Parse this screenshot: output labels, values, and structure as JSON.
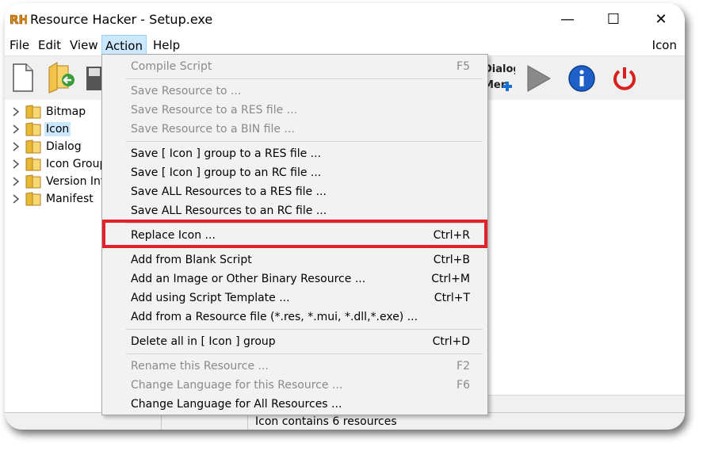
{
  "window": {
    "title": "Resource Hacker - Setup.exe",
    "app_logo_text": "RH",
    "minimize_glyph": "—",
    "maximize_glyph": "☐",
    "close_glyph": "✕"
  },
  "menubar": {
    "items": [
      "File",
      "Edit",
      "View",
      "Action",
      "Help"
    ],
    "active": "Action",
    "right_label": "Icon"
  },
  "toolbar": {
    "icons": [
      "new-file-icon",
      "open-folder-icon",
      "save-icon",
      "dialog-merger-icon",
      "run-script-icon",
      "info-icon",
      "power-icon"
    ],
    "dialog_merger_text_1": "Dialog",
    "dialog_merger_text_2": "Mer"
  },
  "tree": {
    "items": [
      {
        "label": "Bitmap",
        "selected": false
      },
      {
        "label": "Icon",
        "selected": true
      },
      {
        "label": "Dialog",
        "selected": false
      },
      {
        "label": "Icon Group",
        "selected": false
      },
      {
        "label": "Version Info",
        "selected": false
      },
      {
        "label": "Manifest",
        "selected": false
      }
    ]
  },
  "statusbar": {
    "text": "Icon contains 6 resources"
  },
  "action_menu": {
    "compile_script": {
      "label": "Compile Script",
      "shortcut": "F5"
    },
    "save_resource_to": {
      "label": "Save Resource to ..."
    },
    "save_resource_res": {
      "label": "Save Resource to a RES file ..."
    },
    "save_resource_bin": {
      "label": "Save Resource to a BIN file ..."
    },
    "save_group_res": {
      "label": "Save [ Icon ] group to a RES file ..."
    },
    "save_group_rc": {
      "label": "Save [ Icon ] group to an RC file ..."
    },
    "save_all_res": {
      "label": "Save ALL Resources to a RES file ..."
    },
    "save_all_rc": {
      "label": "Save ALL Resources to an RC file ..."
    },
    "replace_icon": {
      "label": "Replace Icon ...",
      "shortcut": "Ctrl+R"
    },
    "add_blank_script": {
      "label": "Add from Blank Script",
      "shortcut": "Ctrl+B"
    },
    "add_image_binary": {
      "label": "Add an Image or Other Binary Resource ...",
      "shortcut": "Ctrl+M"
    },
    "add_script_template": {
      "label": "Add using Script Template ...",
      "shortcut": "Ctrl+T"
    },
    "add_resource_file": {
      "label": "Add from a Resource file (*.res, *.mui, *.dll,*.exe) ..."
    },
    "delete_all_group": {
      "label": "Delete all in [ Icon ] group",
      "shortcut": "Ctrl+D"
    },
    "rename_resource": {
      "label": "Rename this Resource ...",
      "shortcut": "F2"
    },
    "change_language_this": {
      "label": "Change Language for this Resource ...",
      "shortcut": "F6"
    },
    "change_language_all": {
      "label": "Change Language for All Resources ..."
    }
  },
  "colors": {
    "highlight_border": "#e3212b",
    "menu_active_bg": "#cce8ff",
    "disabled_text": "#8a8a8a"
  }
}
